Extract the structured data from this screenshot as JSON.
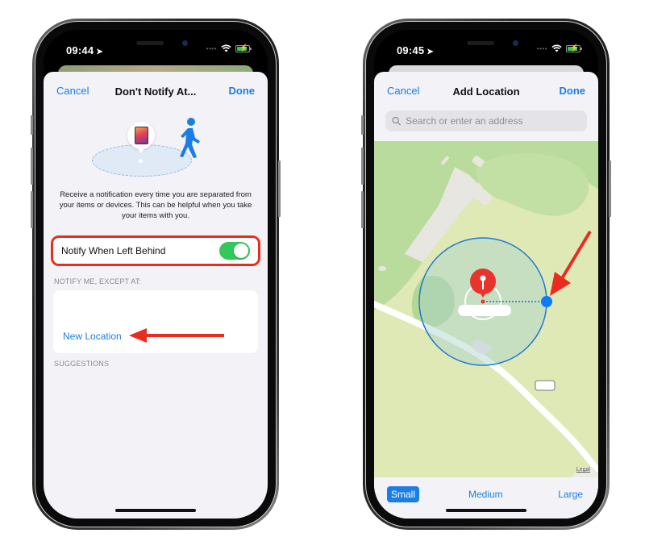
{
  "left_phone": {
    "status_bar": {
      "time": "09:44",
      "location_icon": "location-arrow-icon",
      "wifi_icon": "wifi-icon",
      "battery_icon": "battery-charging-icon"
    },
    "nav": {
      "cancel_label": "Cancel",
      "title": "Don't Notify At...",
      "done_label": "Done"
    },
    "hero": {
      "device_icon": "ipad-icon",
      "person_icon": "walking-person-icon"
    },
    "description": "Receive a notification every time you are separated from your items or devices. This can be helpful when you take your items with you.",
    "toggle_row": {
      "label": "Notify When Left Behind",
      "enabled": true
    },
    "except_section": {
      "header": "NOTIFY ME, EXCEPT AT:",
      "new_location_label": "New Location"
    },
    "suggestions_header": "SUGGESTIONS",
    "annotation": {
      "highlight_color": "#ea2c1f",
      "arrow_color": "#ea2c1f"
    }
  },
  "right_phone": {
    "status_bar": {
      "time": "09:45",
      "location_icon": "location-arrow-icon",
      "wifi_icon": "wifi-icon",
      "battery_icon": "battery-charging-icon"
    },
    "nav": {
      "cancel_label": "Cancel",
      "title": "Add Location",
      "done_label": "Done"
    },
    "search": {
      "placeholder": "Search or enter an address",
      "value": ""
    },
    "map": {
      "legal_label": "Legal",
      "pin_icon": "map-pin-icon",
      "radius_handle": "radius-handle"
    },
    "size_options": [
      {
        "label": "Small",
        "selected": true
      },
      {
        "label": "Medium",
        "selected": false
      },
      {
        "label": "Large",
        "selected": false
      }
    ]
  },
  "colors": {
    "ios_blue": "#1a7ee6",
    "toggle_green": "#34c759",
    "pin_red": "#e8342c",
    "annotation_red": "#ea2c1f"
  }
}
